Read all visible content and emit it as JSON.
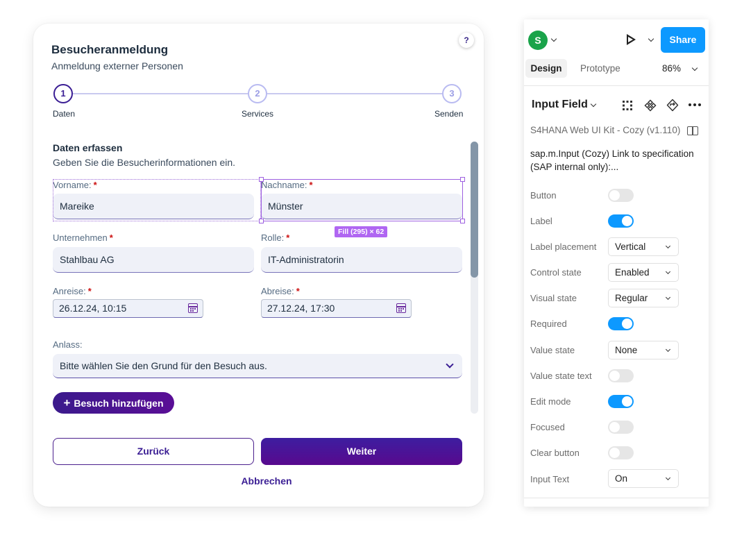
{
  "dialog": {
    "help_glyph": "?",
    "title": "Besucheranmeldung",
    "subtitle": "Anmeldung externer Personen",
    "steps": [
      {
        "number": "1",
        "label": "Daten"
      },
      {
        "number": "2",
        "label": "Services"
      },
      {
        "number": "3",
        "label": "Senden"
      }
    ],
    "section_title": "Daten erfassen",
    "section_subtitle": "Geben Sie die Besucherinformationen ein.",
    "required_marker": "*",
    "fields": {
      "vorname": {
        "label": "Vorname:",
        "value": "Mareike"
      },
      "nachname": {
        "label": "Nachname:",
        "value": "Münster"
      },
      "unternehmen": {
        "label": "Unternehmen",
        "value": "Stahlbau AG"
      },
      "rolle": {
        "label": "Rolle:",
        "value": "IT-Administratorin"
      },
      "anreise": {
        "label": "Anreise:",
        "value": "26.12.24, 10:15"
      },
      "abreise": {
        "label": "Abreise:",
        "value": "27.12.24, 17:30"
      },
      "anlass": {
        "label": "Anlass:",
        "placeholder": "Bitte wählen Sie den Grund für den Besuch aus."
      }
    },
    "add_visit_plus": "+",
    "add_visit_label": "Besuch hinzufügen",
    "back_label": "Zurück",
    "next_label": "Weiter",
    "cancel_label": "Abbrechen",
    "selection_badge": "Fill (295) × 62"
  },
  "panel": {
    "avatar_letter": "S",
    "share_label": "Share",
    "tabs": {
      "design": "Design",
      "prototype": "Prototype"
    },
    "zoom": "86%",
    "component_name": "Input Field",
    "library": "S4HANA Web UI Kit - Cozy (v1.110)",
    "description": "sap.m.Input (Cozy) Link to specification (SAP internal only):...",
    "properties": [
      {
        "label": "Button",
        "kind": "toggle",
        "on": false
      },
      {
        "label": "Label",
        "kind": "toggle",
        "on": true
      },
      {
        "label": "Label placement",
        "kind": "select",
        "value": "Vertical"
      },
      {
        "label": "Control state",
        "kind": "select",
        "value": "Enabled"
      },
      {
        "label": "Visual state",
        "kind": "select",
        "value": "Regular"
      },
      {
        "label": "Required",
        "kind": "toggle",
        "on": true
      },
      {
        "label": "Value state",
        "kind": "select",
        "value": "None"
      },
      {
        "label": "Value state text",
        "kind": "toggle",
        "on": false
      },
      {
        "label": "Edit mode",
        "kind": "toggle",
        "on": true
      },
      {
        "label": "Focused",
        "kind": "toggle",
        "on": false
      },
      {
        "label": "Clear button",
        "kind": "toggle",
        "on": false
      },
      {
        "label": "Input Text",
        "kind": "select",
        "value": "On"
      }
    ]
  },
  "icons": [
    "help-icon",
    "calendar-icon",
    "chevron-down-icon",
    "plus-icon",
    "play-icon",
    "grid-icon",
    "component-icon",
    "swap-icon",
    "more-icon",
    "book-icon"
  ],
  "colors": {
    "brand_purple": "#3b1e94",
    "figma_blue": "#0d99ff",
    "avatar_green": "#1aa34a",
    "selection": "#9d5fe0",
    "required": "#cc1111"
  }
}
